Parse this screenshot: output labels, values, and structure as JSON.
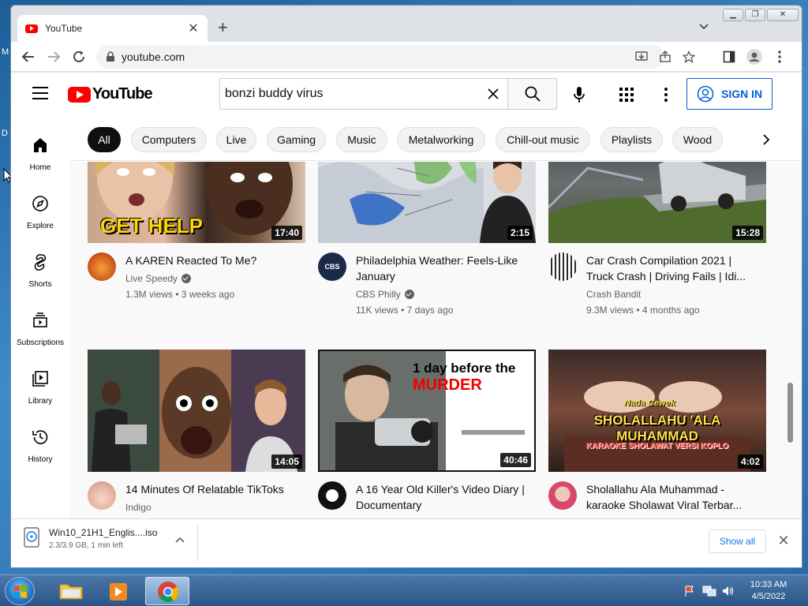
{
  "browser": {
    "tab_title": "YouTube",
    "url": "youtube.com",
    "window_controls": [
      "minimize",
      "restore",
      "close"
    ]
  },
  "youtube": {
    "search_value": "bonzi buddy virus",
    "sign_in_label": "SIGN IN",
    "logo_text": "YouTube",
    "sidebar": [
      {
        "label": "Home",
        "icon": "home-icon"
      },
      {
        "label": "Explore",
        "icon": "compass-icon"
      },
      {
        "label": "Shorts",
        "icon": "shorts-icon"
      },
      {
        "label": "Subscriptions",
        "icon": "subscriptions-icon"
      },
      {
        "label": "Library",
        "icon": "library-icon"
      },
      {
        "label": "History",
        "icon": "history-icon"
      }
    ],
    "chips": [
      "All",
      "Computers",
      "Live",
      "Gaming",
      "Music",
      "Metalworking",
      "Chill-out music",
      "Playlists",
      "Wood"
    ],
    "videos": [
      {
        "title": "A KAREN Reacted To Me?",
        "channel": "Live Speedy",
        "verified": true,
        "views": "1.3M views • 3 weeks ago",
        "duration": "17:40",
        "thumb_text": "GET HELP"
      },
      {
        "title": "Philadelphia Weather: Feels-Like January",
        "channel": "CBS Philly",
        "verified": true,
        "views": "11K views • 7 days ago",
        "duration": "2:15"
      },
      {
        "title": "Car Crash Compilation 2021 | Truck Crash | Driving Fails | Idi...",
        "channel": "Crash Bandit",
        "verified": false,
        "views": "9.3M views • 4 months ago",
        "duration": "15:28"
      },
      {
        "title": "14 Minutes Of Relatable TikToks",
        "channel": "Indigo",
        "verified": false,
        "views": "",
        "duration": "14:05"
      },
      {
        "title": "A 16 Year Old Killer's Video Diary | Documentary",
        "channel": "",
        "verified": false,
        "views": "",
        "duration": "40:46",
        "thumb_text_1": "1 day before the",
        "thumb_text_2": "MURDER"
      },
      {
        "title": "Sholallahu Ala Muhammad - karaoke Sholawat Viral Terbar...",
        "channel": "",
        "verified": false,
        "views": "",
        "duration": "4:02",
        "thumb_text_1": "Nada Cewek",
        "thumb_text_2": "SHOLALLAHU 'ALA MUHAMMAD",
        "thumb_text_3": "KARAOKE SHOLAWAT VERSI KOPLO"
      }
    ]
  },
  "download": {
    "filename": "Win10_21H1_Englis....iso",
    "status": "2.3/3.9 GB, 1 min left",
    "show_all_label": "Show all"
  },
  "taskbar": {
    "time": "10:33 AM",
    "date": "4/5/2022"
  }
}
